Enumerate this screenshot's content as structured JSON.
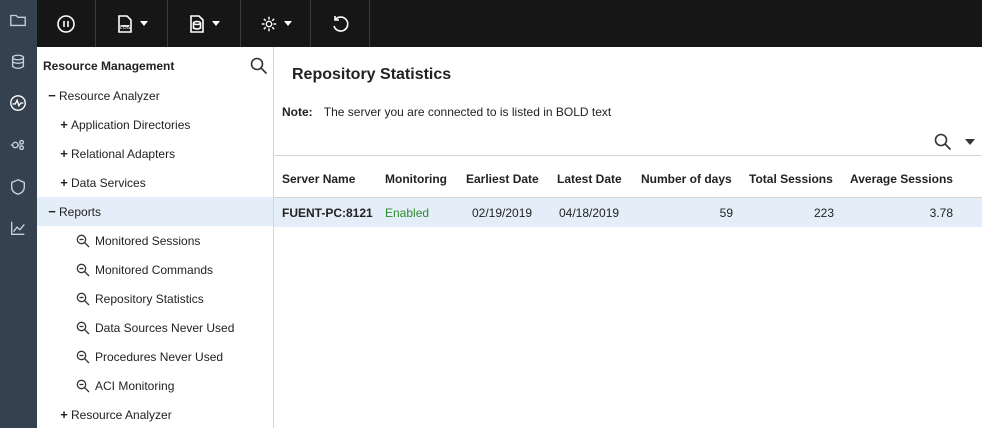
{
  "rail": {
    "icons": [
      "folder-icon",
      "database-icon",
      "monitor-icon",
      "settings-cog-icon",
      "shield-icon",
      "chart-icon"
    ]
  },
  "toolbar": {
    "buttons": [
      "pause-icon",
      "log-icon",
      "database-report-icon",
      "gear-icon",
      "refresh-icon"
    ]
  },
  "tree": {
    "title": "Resource Management",
    "items": [
      {
        "label": "Resource Analyzer",
        "expander": "−"
      },
      {
        "label": "Application Directories",
        "expander": "+"
      },
      {
        "label": "Relational Adapters",
        "expander": "+"
      },
      {
        "label": "Data Services",
        "expander": "+"
      },
      {
        "label": "Reports",
        "expander": "−"
      },
      {
        "label": "Monitored Sessions"
      },
      {
        "label": "Monitored Commands"
      },
      {
        "label": "Repository Statistics"
      },
      {
        "label": "Data Sources Never Used"
      },
      {
        "label": "Procedures Never Used"
      },
      {
        "label": "ACI Monitoring"
      },
      {
        "label": "Resource Analyzer",
        "expander": "+"
      }
    ]
  },
  "main": {
    "title": "Repository Statistics",
    "note_label": "Note:",
    "note_text": "The server you are connected to is listed in BOLD text",
    "columns": [
      "Server Name",
      "Monitoring",
      "Earliest Date",
      "Latest Date",
      "Number of days",
      "Total Sessions",
      "Average Sessions"
    ],
    "rows": [
      {
        "server": "FUENT-PC:8121",
        "monitoring": "Enabled",
        "earliest": "02/19/2019",
        "latest": "04/18/2019",
        "days": "59",
        "total": "223",
        "average": "3.78"
      }
    ]
  },
  "colors": {
    "rail": "#364150",
    "toolbar": "#161616",
    "selection": "#e4eef8",
    "enabled": "#2e8b2e"
  }
}
